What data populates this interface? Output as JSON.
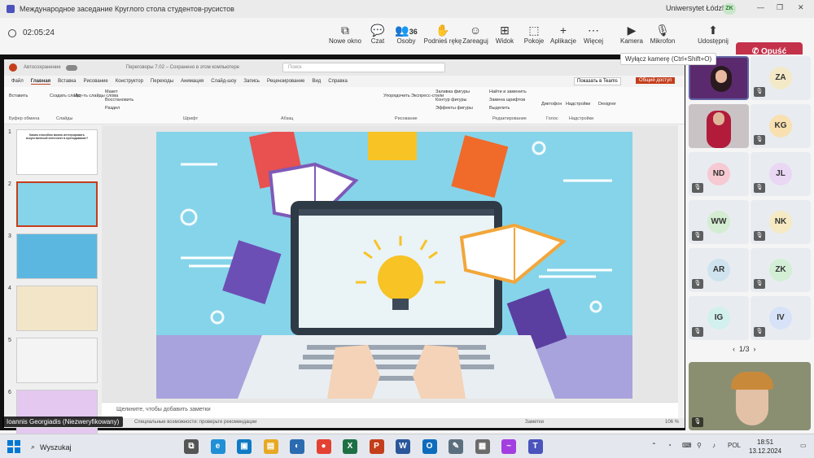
{
  "window": {
    "title": "Международное заседание Круглого стола студентов-русистов",
    "org": "Uniwersytet Łódzki",
    "org_initials": "ZK",
    "minimize": "—",
    "restore": "❐",
    "close": "✕"
  },
  "meeting": {
    "timer": "02:05:24",
    "buttons": [
      {
        "label": "Nowe okno",
        "icon": "new-window-icon",
        "glyph": "⧉"
      },
      {
        "label": "Czat",
        "icon": "chat-icon",
        "glyph": "💬"
      },
      {
        "label": "Osoby",
        "icon": "people-icon",
        "glyph": "👥",
        "badge": "36"
      },
      {
        "label": "Podnieś rękę",
        "icon": "hand-icon",
        "glyph": "✋"
      },
      {
        "label": "Zareaguj",
        "icon": "smile-icon",
        "glyph": "☺"
      },
      {
        "label": "Widok",
        "icon": "grid-icon",
        "glyph": "⊞"
      },
      {
        "label": "Pokoje",
        "icon": "rooms-icon",
        "glyph": "⬚"
      },
      {
        "label": "Aplikacje",
        "icon": "apps-icon",
        "glyph": "+"
      },
      {
        "label": "Więcej",
        "icon": "more-icon",
        "glyph": "⋯"
      },
      {
        "label": "Kamera",
        "icon": "camera-icon",
        "glyph": "▶"
      },
      {
        "label": "Mikrofon",
        "icon": "mic-off-icon",
        "glyph": "🎙"
      },
      {
        "label": "Udostępnij",
        "icon": "share-icon",
        "glyph": "⬆"
      }
    ],
    "leave_label": "Opuść",
    "tooltip": "Wyłącz kamerę (Ctrl+Shift+O)"
  },
  "ppt": {
    "autosave": "Автосохранение",
    "filename": "Переговоры 7.02 – Сохранено в этом компьютере",
    "search": "Поиск",
    "tabs": [
      "Файл",
      "Главная",
      "Вставка",
      "Рисование",
      "Конструктор",
      "Переходы",
      "Анимация",
      "Слайд-шоу",
      "Запись",
      "Рецензирование",
      "Вид",
      "Справка"
    ],
    "record": "Запись",
    "teams": "Показать в Teams",
    "share": "Общий доступ",
    "ribbon_items": [
      "Вставить",
      "Создать слайд",
      "Исп-ть слайды слова",
      "Макет",
      "Восстановить",
      "Раздел",
      "Упорядочить",
      "Экспресс-стили",
      "Заливка фигуры",
      "Контур фигуры",
      "Эффекты фигуры",
      "Найти и заменить",
      "Замена шрифтов",
      "Выделить",
      "Диктофон",
      "Надстройки",
      "Designer"
    ],
    "groups": [
      "Буфер обмена",
      "Слайды",
      "Шрифт",
      "Абзац",
      "Рисование",
      "Редактирование",
      "Голос",
      "Надстройки"
    ],
    "thumb_title": "Каким способом можно интегрировать искусственный интеллект в преподавание?",
    "thumbs": [
      "1",
      "2",
      "3",
      "4",
      "5",
      "6"
    ],
    "notes": "Щелкните, чтобы добавить заметки",
    "status_left": "Специальные возможности: проверьте рекомендации",
    "status_notes": "Заметки",
    "zoom": "106 %"
  },
  "presenter": "Ioannis Georgiadis (Niezweryfikowany)",
  "gallery": {
    "tiles": [
      {
        "initials": "ZA",
        "color": "#f3e9c6"
      },
      {
        "initials": "KG",
        "color": "#f8e0b0"
      },
      {
        "initials": "ND",
        "color": "#f7c9d2"
      },
      {
        "initials": "JL",
        "color": "#ead7f4"
      },
      {
        "initials": "WW",
        "color": "#d4ecd2"
      },
      {
        "initials": "NK",
        "color": "#f5eac3"
      },
      {
        "initials": "AR",
        "color": "#cfe3ee"
      },
      {
        "initials": "ZK",
        "color": "#d2efd6"
      },
      {
        "initials": "IG",
        "color": "#d2f0ee"
      },
      {
        "initials": "IV",
        "color": "#d7e2f8"
      }
    ],
    "page": "1/3"
  },
  "taskbar": {
    "search": "Wyszukaj",
    "time": "18:51",
    "date": "13.12.2024",
    "lang": "POL",
    "apps": [
      {
        "name": "task-view-icon",
        "glyph": "⧉",
        "color": "#555"
      },
      {
        "name": "edge-icon",
        "glyph": "e",
        "color": "#1f8fd6"
      },
      {
        "name": "photos-icon",
        "glyph": "▣",
        "color": "#0f7bc4"
      },
      {
        "name": "files-icon",
        "glyph": "▤",
        "color": "#e7a823"
      },
      {
        "name": "browser-icon",
        "glyph": "◐",
        "color": "#2b6cb0"
      },
      {
        "name": "chrome-icon",
        "glyph": "●",
        "color": "#e34133"
      },
      {
        "name": "excel-icon",
        "glyph": "X",
        "color": "#1d7044"
      },
      {
        "name": "powerpoint-icon",
        "glyph": "P",
        "color": "#c43e1c"
      },
      {
        "name": "word-icon",
        "glyph": "W",
        "color": "#2b579a"
      },
      {
        "name": "outlook-icon",
        "glyph": "O",
        "color": "#0f6cbd"
      },
      {
        "name": "paint-icon",
        "glyph": "✎",
        "color": "#5c6f7e"
      },
      {
        "name": "calculator-icon",
        "glyph": "▦",
        "color": "#6b6b6b"
      },
      {
        "name": "messenger-icon",
        "glyph": "~",
        "color": "#a33fe0"
      },
      {
        "name": "teams-icon",
        "glyph": "T",
        "color": "#4b53bc"
      }
    ]
  }
}
